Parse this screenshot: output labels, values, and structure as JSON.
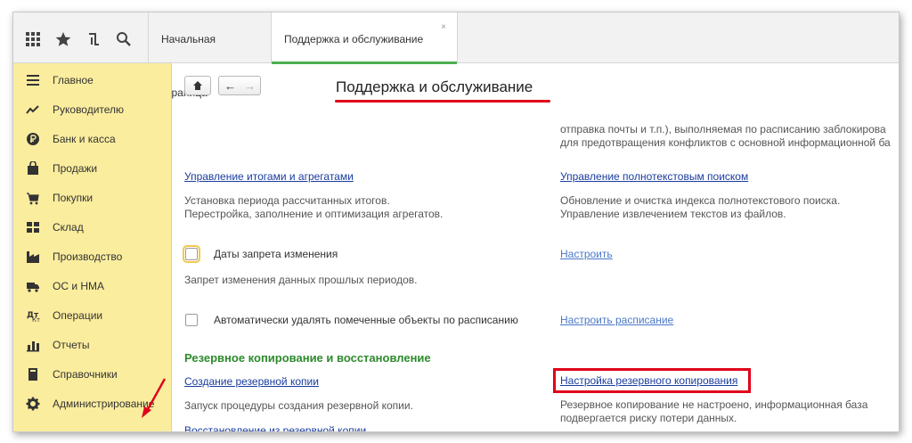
{
  "topbar": {
    "icons": [
      "apps-grid-icon",
      "star-icon",
      "history-icon",
      "search-icon"
    ],
    "tabs": [
      {
        "label": "Начальная страница"
      },
      {
        "label": "Поддержка и обслуживание",
        "close": "×"
      }
    ]
  },
  "sidebar": {
    "items": [
      {
        "label": "Главное",
        "icon": "menu-icon"
      },
      {
        "label": "Руководителю",
        "icon": "trend-icon"
      },
      {
        "label": "Банк и касса",
        "icon": "ruble-icon"
      },
      {
        "label": "Продажи",
        "icon": "bag-icon"
      },
      {
        "label": "Покупки",
        "icon": "cart-icon"
      },
      {
        "label": "Склад",
        "icon": "warehouse-icon"
      },
      {
        "label": "Производство",
        "icon": "factory-icon"
      },
      {
        "label": "ОС и НМА",
        "icon": "truck-icon"
      },
      {
        "label": "Операции",
        "icon": "operations-icon"
      },
      {
        "label": "Отчеты",
        "icon": "chart-icon"
      },
      {
        "label": "Справочники",
        "icon": "book-icon"
      },
      {
        "label": "Администрирование",
        "icon": "gear-icon"
      }
    ]
  },
  "page": {
    "title": "Поддержка и обслуживание",
    "nav": {
      "home": "⌂",
      "back": "←",
      "forward": "→"
    },
    "right_top_text_1": "отправка почты и т.п.), выполняемая по расписанию заблокирова",
    "right_top_text_2": "для предотвращения конфликтов с основной информационной ба",
    "totals_link": "Управление итогами и агрегатами",
    "totals_desc_1": "Установка периода рассчитанных итогов.",
    "totals_desc_2": "Перестройка, заполнение и оптимизация агрегатов.",
    "fulltext_link": "Управление полнотекстовым поиском",
    "fulltext_desc_1": "Обновление и очистка индекса полнотекстового поиска.",
    "fulltext_desc_2": "Управление извлечением текстов из файлов.",
    "lock_dates_label": "Даты запрета изменения",
    "lock_dates_desc": "Запрет изменения данных прошлых периодов.",
    "lock_dates_link": "Настроить",
    "auto_delete_label": "Автоматически удалять помеченные объекты по расписанию",
    "auto_delete_link": "Настроить расписание",
    "backup_section": "Резервное копирование и восстановление",
    "backup_create_link": "Создание резервной копии",
    "backup_create_desc": "Запуск процедуры создания резервной копии.",
    "backup_settings_link": "Настройка резервного копирования",
    "backup_settings_desc_1": "Резервное копирование не настроено, информационная база",
    "backup_settings_desc_2": "подвергается риску потери данных.",
    "restore_link": "Восстановление из резервной копии"
  }
}
